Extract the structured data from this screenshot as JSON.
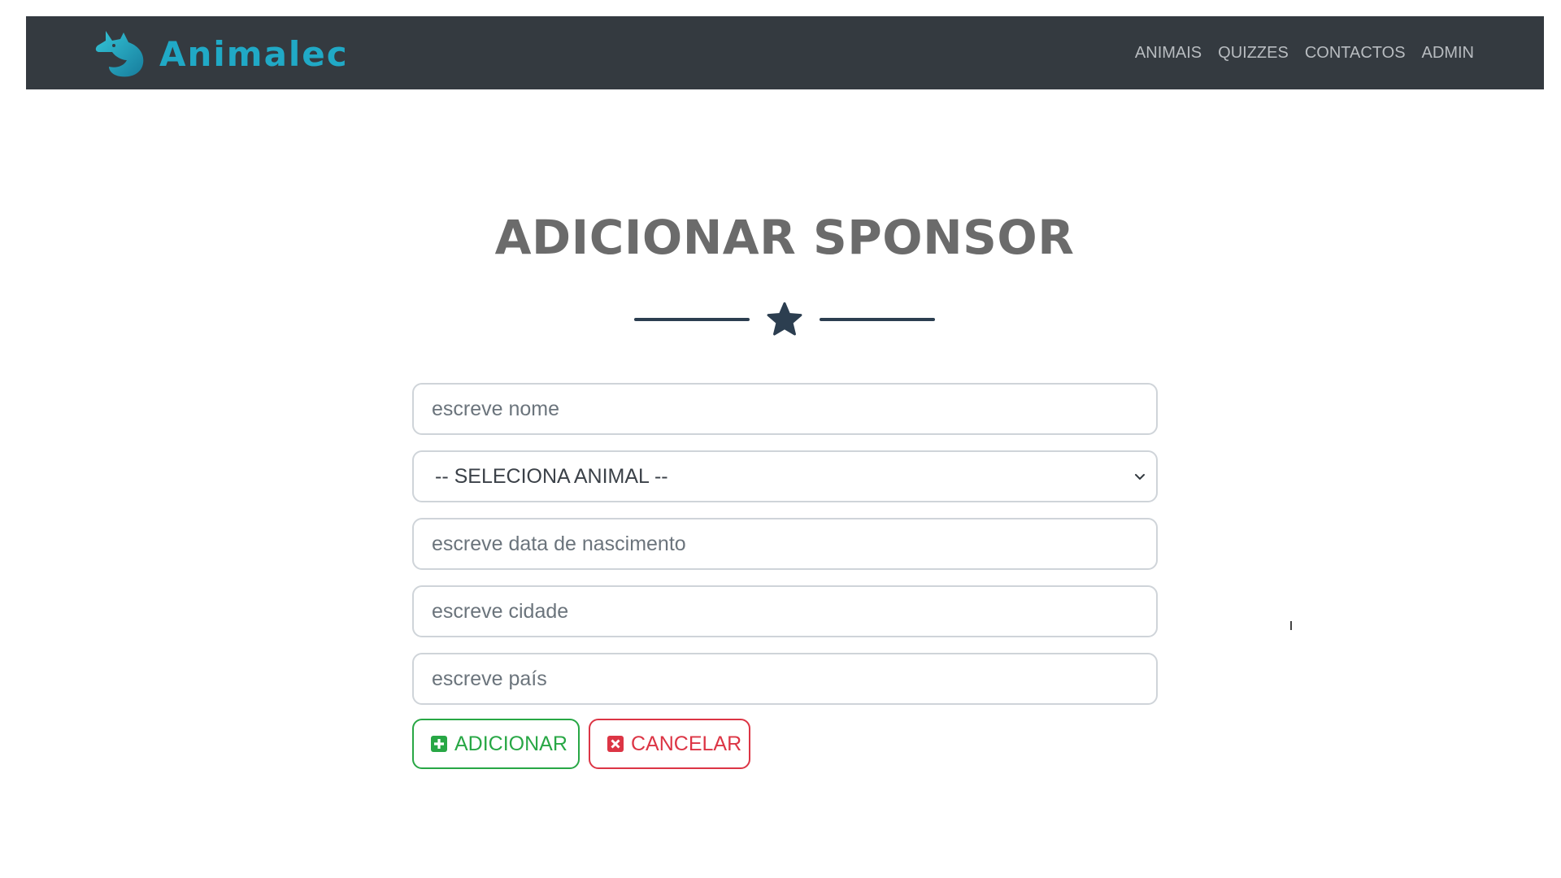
{
  "navbar": {
    "brand_name": "Animalec",
    "links": [
      "ANIMAIS",
      "QUIZZES",
      "CONTACTOS",
      "ADMIN"
    ]
  },
  "page": {
    "title": "ADICIONAR SPONSOR"
  },
  "form": {
    "name_placeholder": "escreve nome",
    "animal_select_value": "-- SELECIONA ANIMAL --",
    "birthdate_placeholder": "escreve data de nascimento",
    "city_placeholder": "escreve cidade",
    "country_placeholder": "escreve país",
    "add_label": "ADICIONAR",
    "cancel_label": "CANCELAR"
  },
  "colors": {
    "navbar_bg": "#343a40",
    "brand": "#20a9c6",
    "title": "#6b6b6b",
    "divider": "#2c3e50",
    "success": "#28a745",
    "danger": "#dc3545"
  },
  "icons": {
    "brand": "dog-head-logo",
    "divider": "star-icon",
    "select": "chevron-down-icon",
    "add": "plus-square-icon",
    "cancel": "close-square-icon"
  }
}
